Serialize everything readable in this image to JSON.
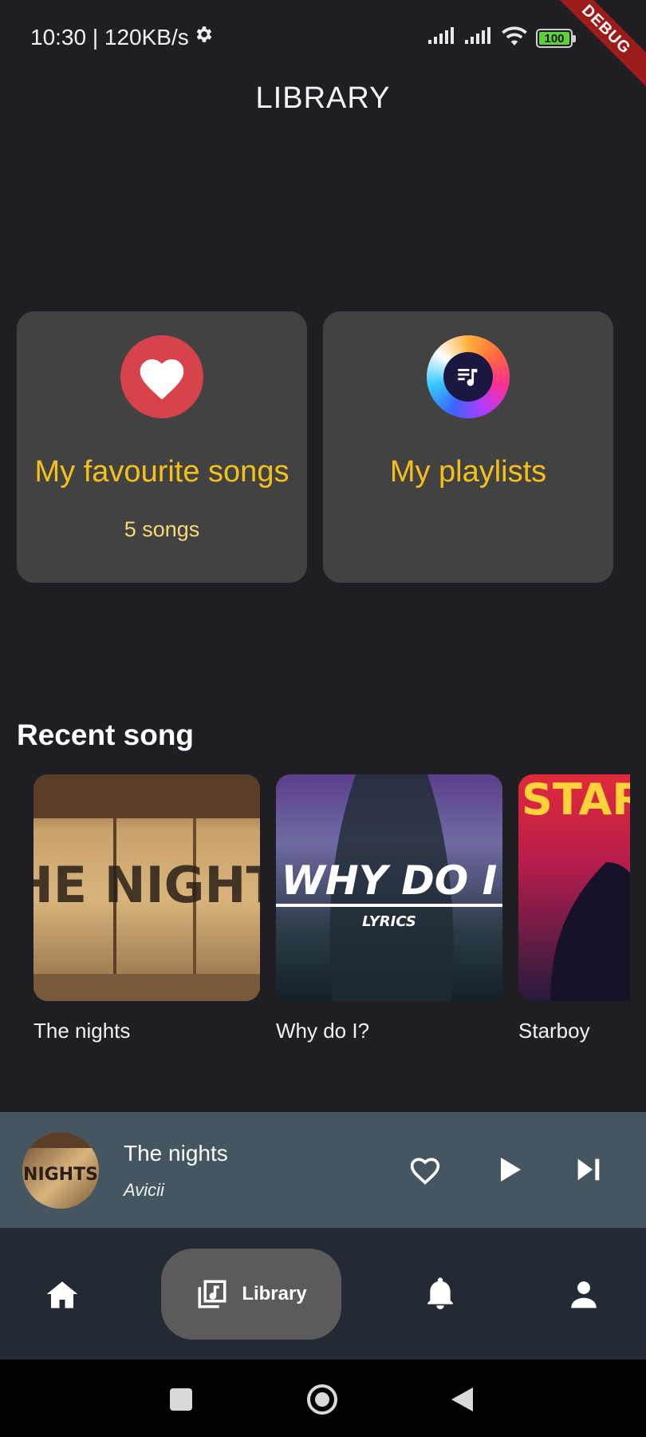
{
  "status_bar": {
    "time_speed": "10:30 | 120KB/s",
    "battery": "100",
    "debug_label": "DEBUG"
  },
  "app": {
    "title": "LIBRARY"
  },
  "cards": {
    "favourites": {
      "title": "My favourite songs",
      "subtitle": "5 songs"
    },
    "playlists": {
      "title": "My playlists"
    }
  },
  "recent": {
    "heading": "Recent song",
    "items": [
      {
        "name": "The nights",
        "cover_text": "THE NIGHTS"
      },
      {
        "name": "Why do I?",
        "cover_text": "WHY DO I",
        "cover_sub": "LYRICS"
      },
      {
        "name": "Starboy",
        "cover_text": "STAR"
      }
    ]
  },
  "player": {
    "title": "The nights",
    "artist": "Avicii",
    "cover_text": "NIGHTS"
  },
  "nav": {
    "home_icon": "home-icon",
    "library_label": "Library",
    "notifications_icon": "bell-icon",
    "profile_icon": "person-icon"
  },
  "colors": {
    "background": "#1f1e23",
    "card": "#434243",
    "accent": "#f4c019",
    "player": "#465661",
    "nav": "#232a33"
  }
}
